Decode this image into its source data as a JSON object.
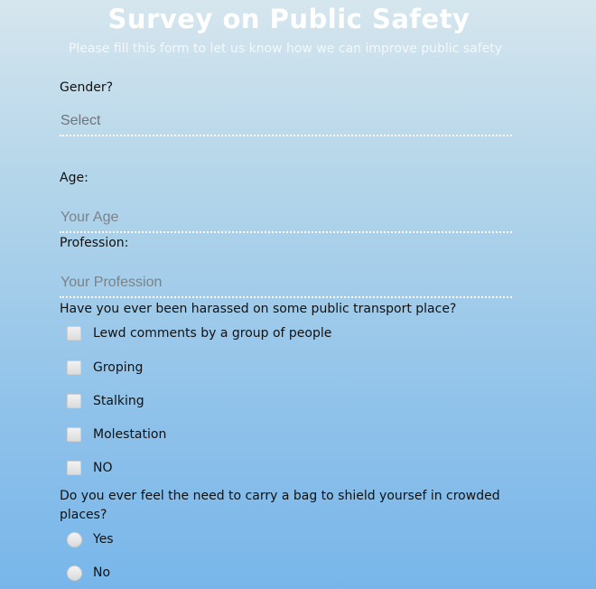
{
  "header": {
    "title": "Survey on Public Safety",
    "subtitle": "Please fill this form to let us know how we can improve public safety"
  },
  "form": {
    "gender": {
      "label": "Gender?",
      "placeholder": "Select"
    },
    "age": {
      "label": "Age:",
      "placeholder": "Your Age"
    },
    "profession": {
      "label": "Profession:",
      "placeholder": "Your Profession"
    },
    "harassment": {
      "question": "Have you ever been harassed on some public transport place?",
      "options": [
        "Lewd comments by a group of people",
        "Groping",
        "Stalking",
        "Molestation",
        "NO"
      ]
    },
    "bag": {
      "question": "Do you ever feel the need to carry a bag to shield yoursef in crowded places?",
      "options": [
        "Yes",
        "No"
      ]
    }
  }
}
